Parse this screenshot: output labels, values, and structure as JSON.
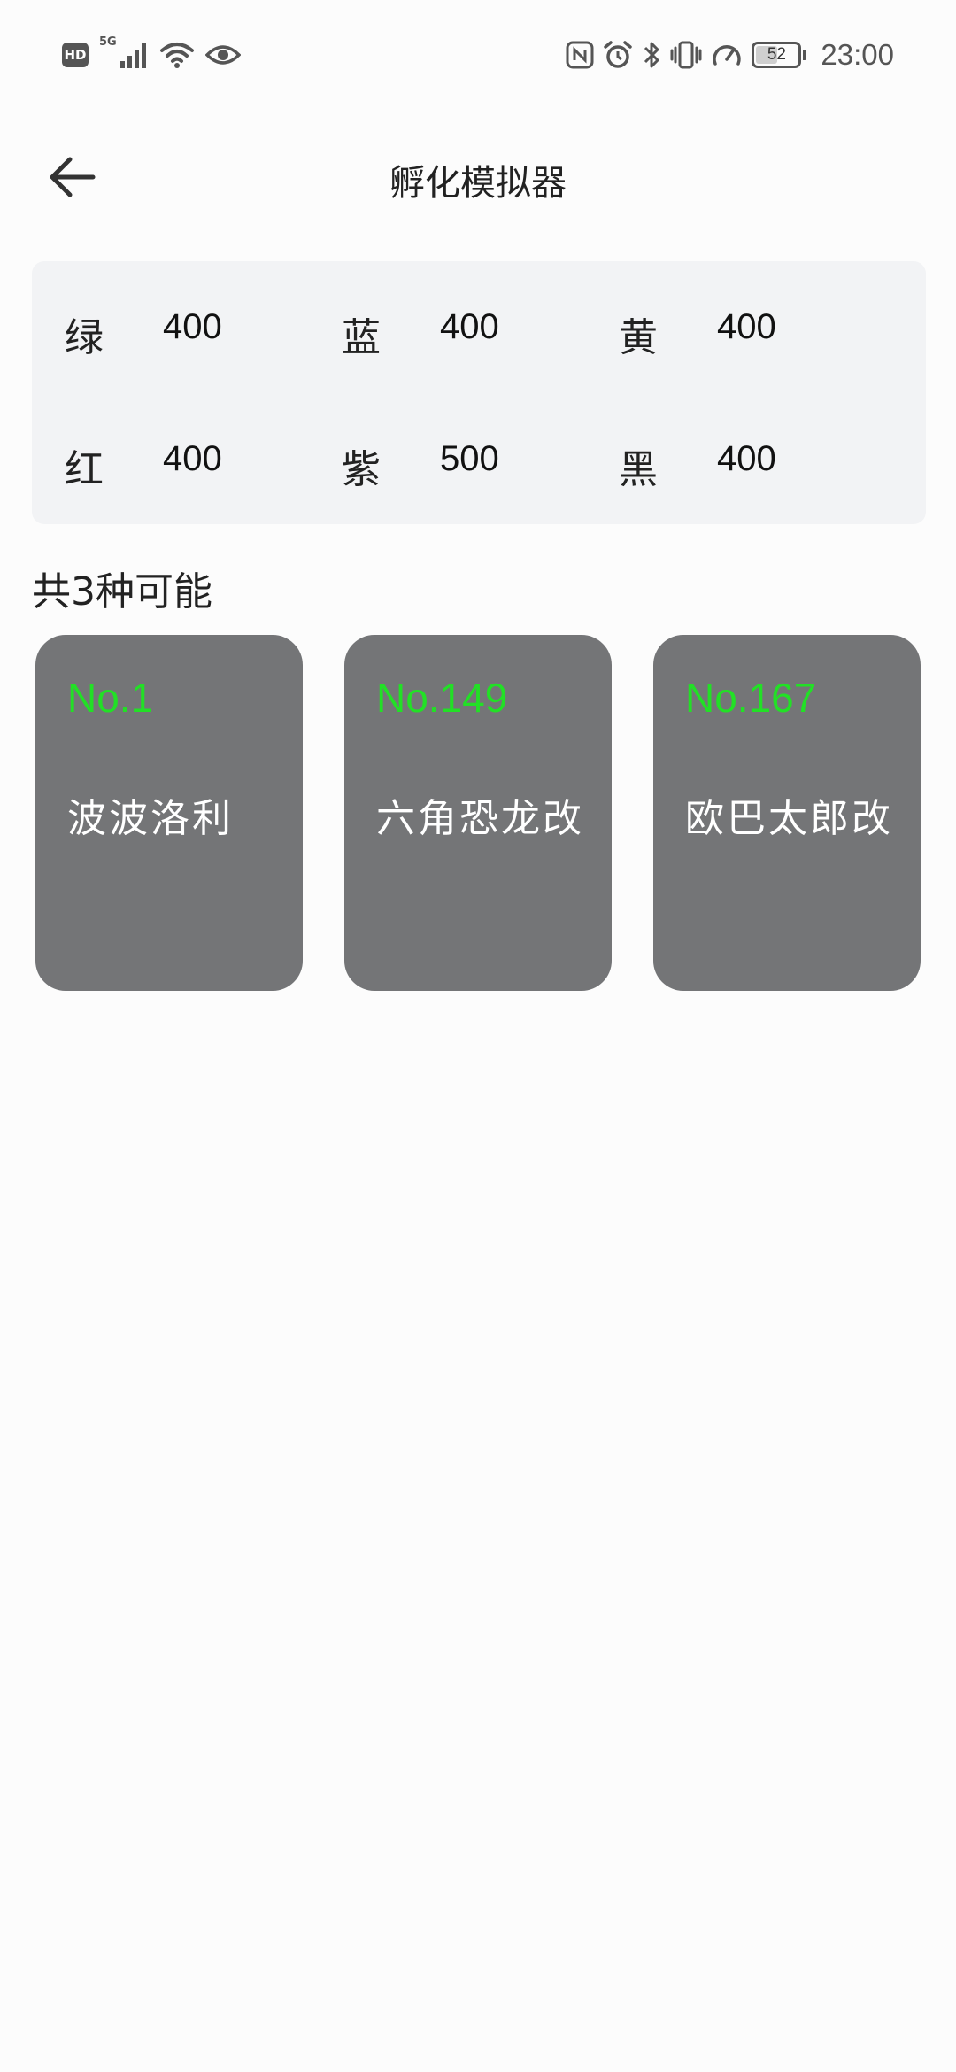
{
  "status_bar": {
    "hd": "HD",
    "network": "5G",
    "battery": "52",
    "battery_level": 0.52,
    "time": "23:00",
    "icons_left": [
      "hd-icon",
      "signal-icon",
      "wifi-icon",
      "eye-icon"
    ],
    "icons_right": [
      "nfc-icon",
      "alarm-icon",
      "bluetooth-icon",
      "vibrate-icon",
      "speed-icon",
      "battery-icon"
    ]
  },
  "header": {
    "title": "孵化模拟器",
    "back_icon": "arrow-left-icon"
  },
  "stats": [
    {
      "name": "绿",
      "value": "400"
    },
    {
      "name": "蓝",
      "value": "400"
    },
    {
      "name": "黄",
      "value": "400"
    },
    {
      "name": "红",
      "value": "400"
    },
    {
      "name": "紫",
      "value": "500"
    },
    {
      "name": "黑",
      "value": "400"
    }
  ],
  "results": {
    "count_label": "共3种可能",
    "cards": [
      {
        "number": "No.1",
        "name": "波波洛利"
      },
      {
        "number": "No.149",
        "name": "六角恐龙改"
      },
      {
        "number": "No.167",
        "name": "欧巴太郎改"
      }
    ]
  },
  "colors": {
    "background": "#fcfcfc",
    "panel": "#f2f3f5",
    "card": "#747577",
    "card_number": "#22e026",
    "card_name": "#ffffff"
  }
}
